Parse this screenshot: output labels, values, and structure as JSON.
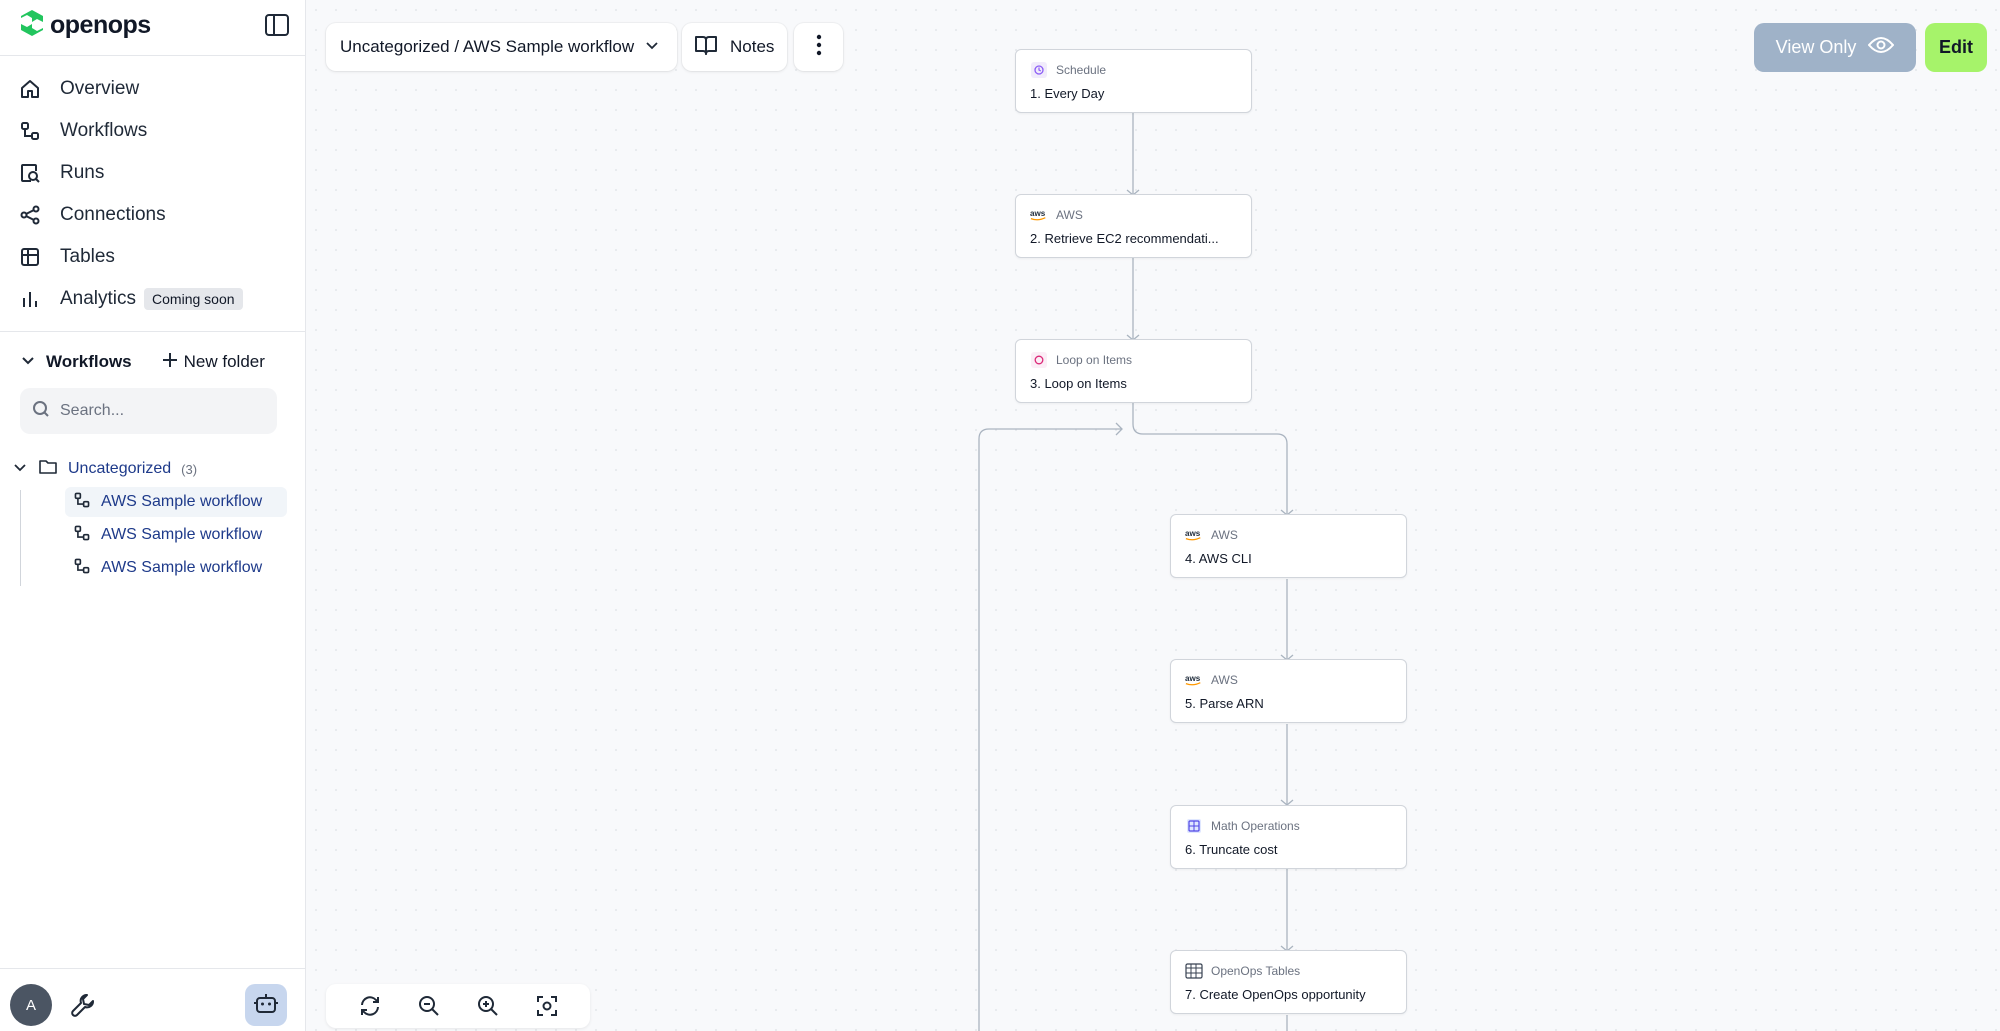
{
  "app": {
    "name": "openops"
  },
  "sidebar": {
    "nav": [
      {
        "label": "Overview",
        "icon": "home-icon"
      },
      {
        "label": "Workflows",
        "icon": "workflow-icon"
      },
      {
        "label": "Runs",
        "icon": "runs-search-icon"
      },
      {
        "label": "Connections",
        "icon": "share-nodes-icon"
      },
      {
        "label": "Tables",
        "icon": "table-icon"
      },
      {
        "label": "Analytics",
        "icon": "bar-chart-icon",
        "badge": "Coming soon"
      }
    ],
    "workflows_section": {
      "title": "Workflows",
      "new_folder_label": "New folder",
      "search_placeholder": "Search...",
      "folder": {
        "name": "Uncategorized",
        "count": "(3)"
      },
      "items": [
        {
          "label": "AWS Sample workflow",
          "active": true
        },
        {
          "label": "AWS Sample workflow",
          "active": false
        },
        {
          "label": "AWS Sample workflow",
          "active": false
        }
      ]
    },
    "user": {
      "initial": "A"
    }
  },
  "toolbar": {
    "breadcrumb": "Uncategorized / AWS Sample workflow",
    "notes_label": "Notes",
    "view_only_label": "View Only",
    "edit_label": "Edit"
  },
  "flow": {
    "nodes": [
      {
        "type": "Schedule",
        "title": "1. Every Day",
        "icon": "schedule-icon"
      },
      {
        "type": "AWS",
        "title": "2. Retrieve EC2 recommendati...",
        "icon": "aws-icon"
      },
      {
        "type": "Loop on Items",
        "title": "3. Loop on Items",
        "icon": "loop-icon"
      },
      {
        "type": "AWS",
        "title": "4. AWS CLI",
        "icon": "aws-icon"
      },
      {
        "type": "AWS",
        "title": "5. Parse ARN",
        "icon": "aws-icon"
      },
      {
        "type": "Math Operations",
        "title": "6. Truncate cost",
        "icon": "math-icon"
      },
      {
        "type": "OpenOps Tables",
        "title": "7. Create OpenOps opportunity",
        "icon": "tables-icon"
      }
    ]
  },
  "colors": {
    "accent_green": "#a6f36a",
    "view_only_bg": "#9fb2c8",
    "brand_green": "#22c55e",
    "link_blue": "#1e3a8a",
    "canvas_bg": "#f8f9fb"
  }
}
